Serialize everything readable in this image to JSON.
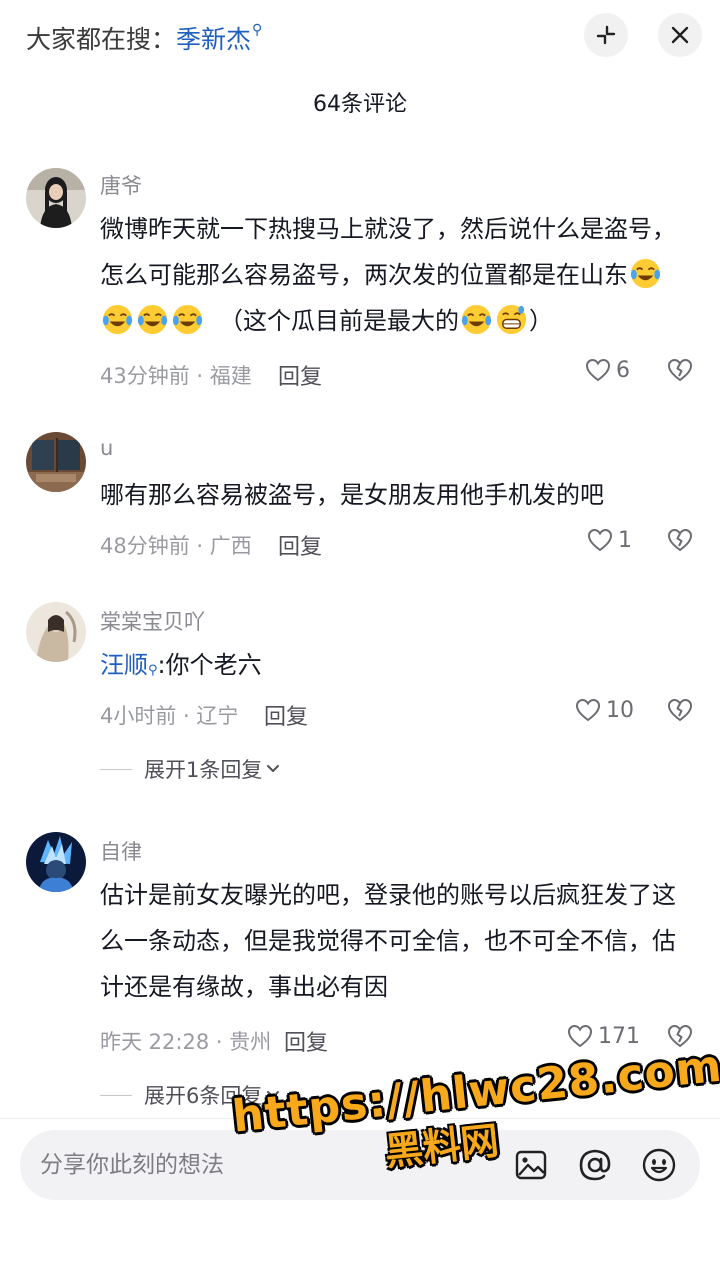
{
  "header": {
    "search_prefix": "大家都在搜：",
    "search_keyword": "季新杰",
    "comment_count": "64条评论"
  },
  "comments": [
    {
      "username": "唐爷",
      "text_line1": "微博昨天就一下热搜马上就没了，然后说什么是盗号，",
      "text_line2": "怎么可能那么容易盗号，两次发的位置都是在山东",
      "text_line3": "（这个瓜目前是最大的",
      "text_line3_end": "）",
      "meta": "43分钟前 · 福建",
      "reply": "回复",
      "likes": "6"
    },
    {
      "username": "u",
      "text": "哪有那么容易被盗号，是女朋友用他手机发的吧",
      "meta": "48分钟前 · 广西",
      "reply": "回复",
      "likes": "1"
    },
    {
      "username": "棠棠宝贝吖",
      "mention": "汪顺",
      "text": ":你个老六",
      "meta": "4小时前 · 辽宁",
      "reply": "回复",
      "likes": "10",
      "expand": "展开1条回复"
    },
    {
      "username": "自律",
      "text_line1": "估计是前女友曝光的吧，登录他的账号以后疯狂发了这",
      "text_line2": "么一条动态，但是我觉得不可全信，也不可全不信，估",
      "text_line3": "计还是有缘故，事出必有因",
      "meta": "昨天 22:28 · 贵州",
      "reply": "回复",
      "likes": "171",
      "expand": "展开6条回复"
    }
  ],
  "input": {
    "placeholder": "分享你此刻的想法"
  },
  "watermark": {
    "url": "https://hlwc28.com",
    "name": "黑料网"
  },
  "icons": {
    "search_hint": "search-icon",
    "shrink": "shrink-icon",
    "close": "close-icon",
    "like": "heart-icon",
    "dislike": "broken-heart-icon",
    "image": "image-icon",
    "mention": "at-icon",
    "emoji": "emoji-icon"
  }
}
